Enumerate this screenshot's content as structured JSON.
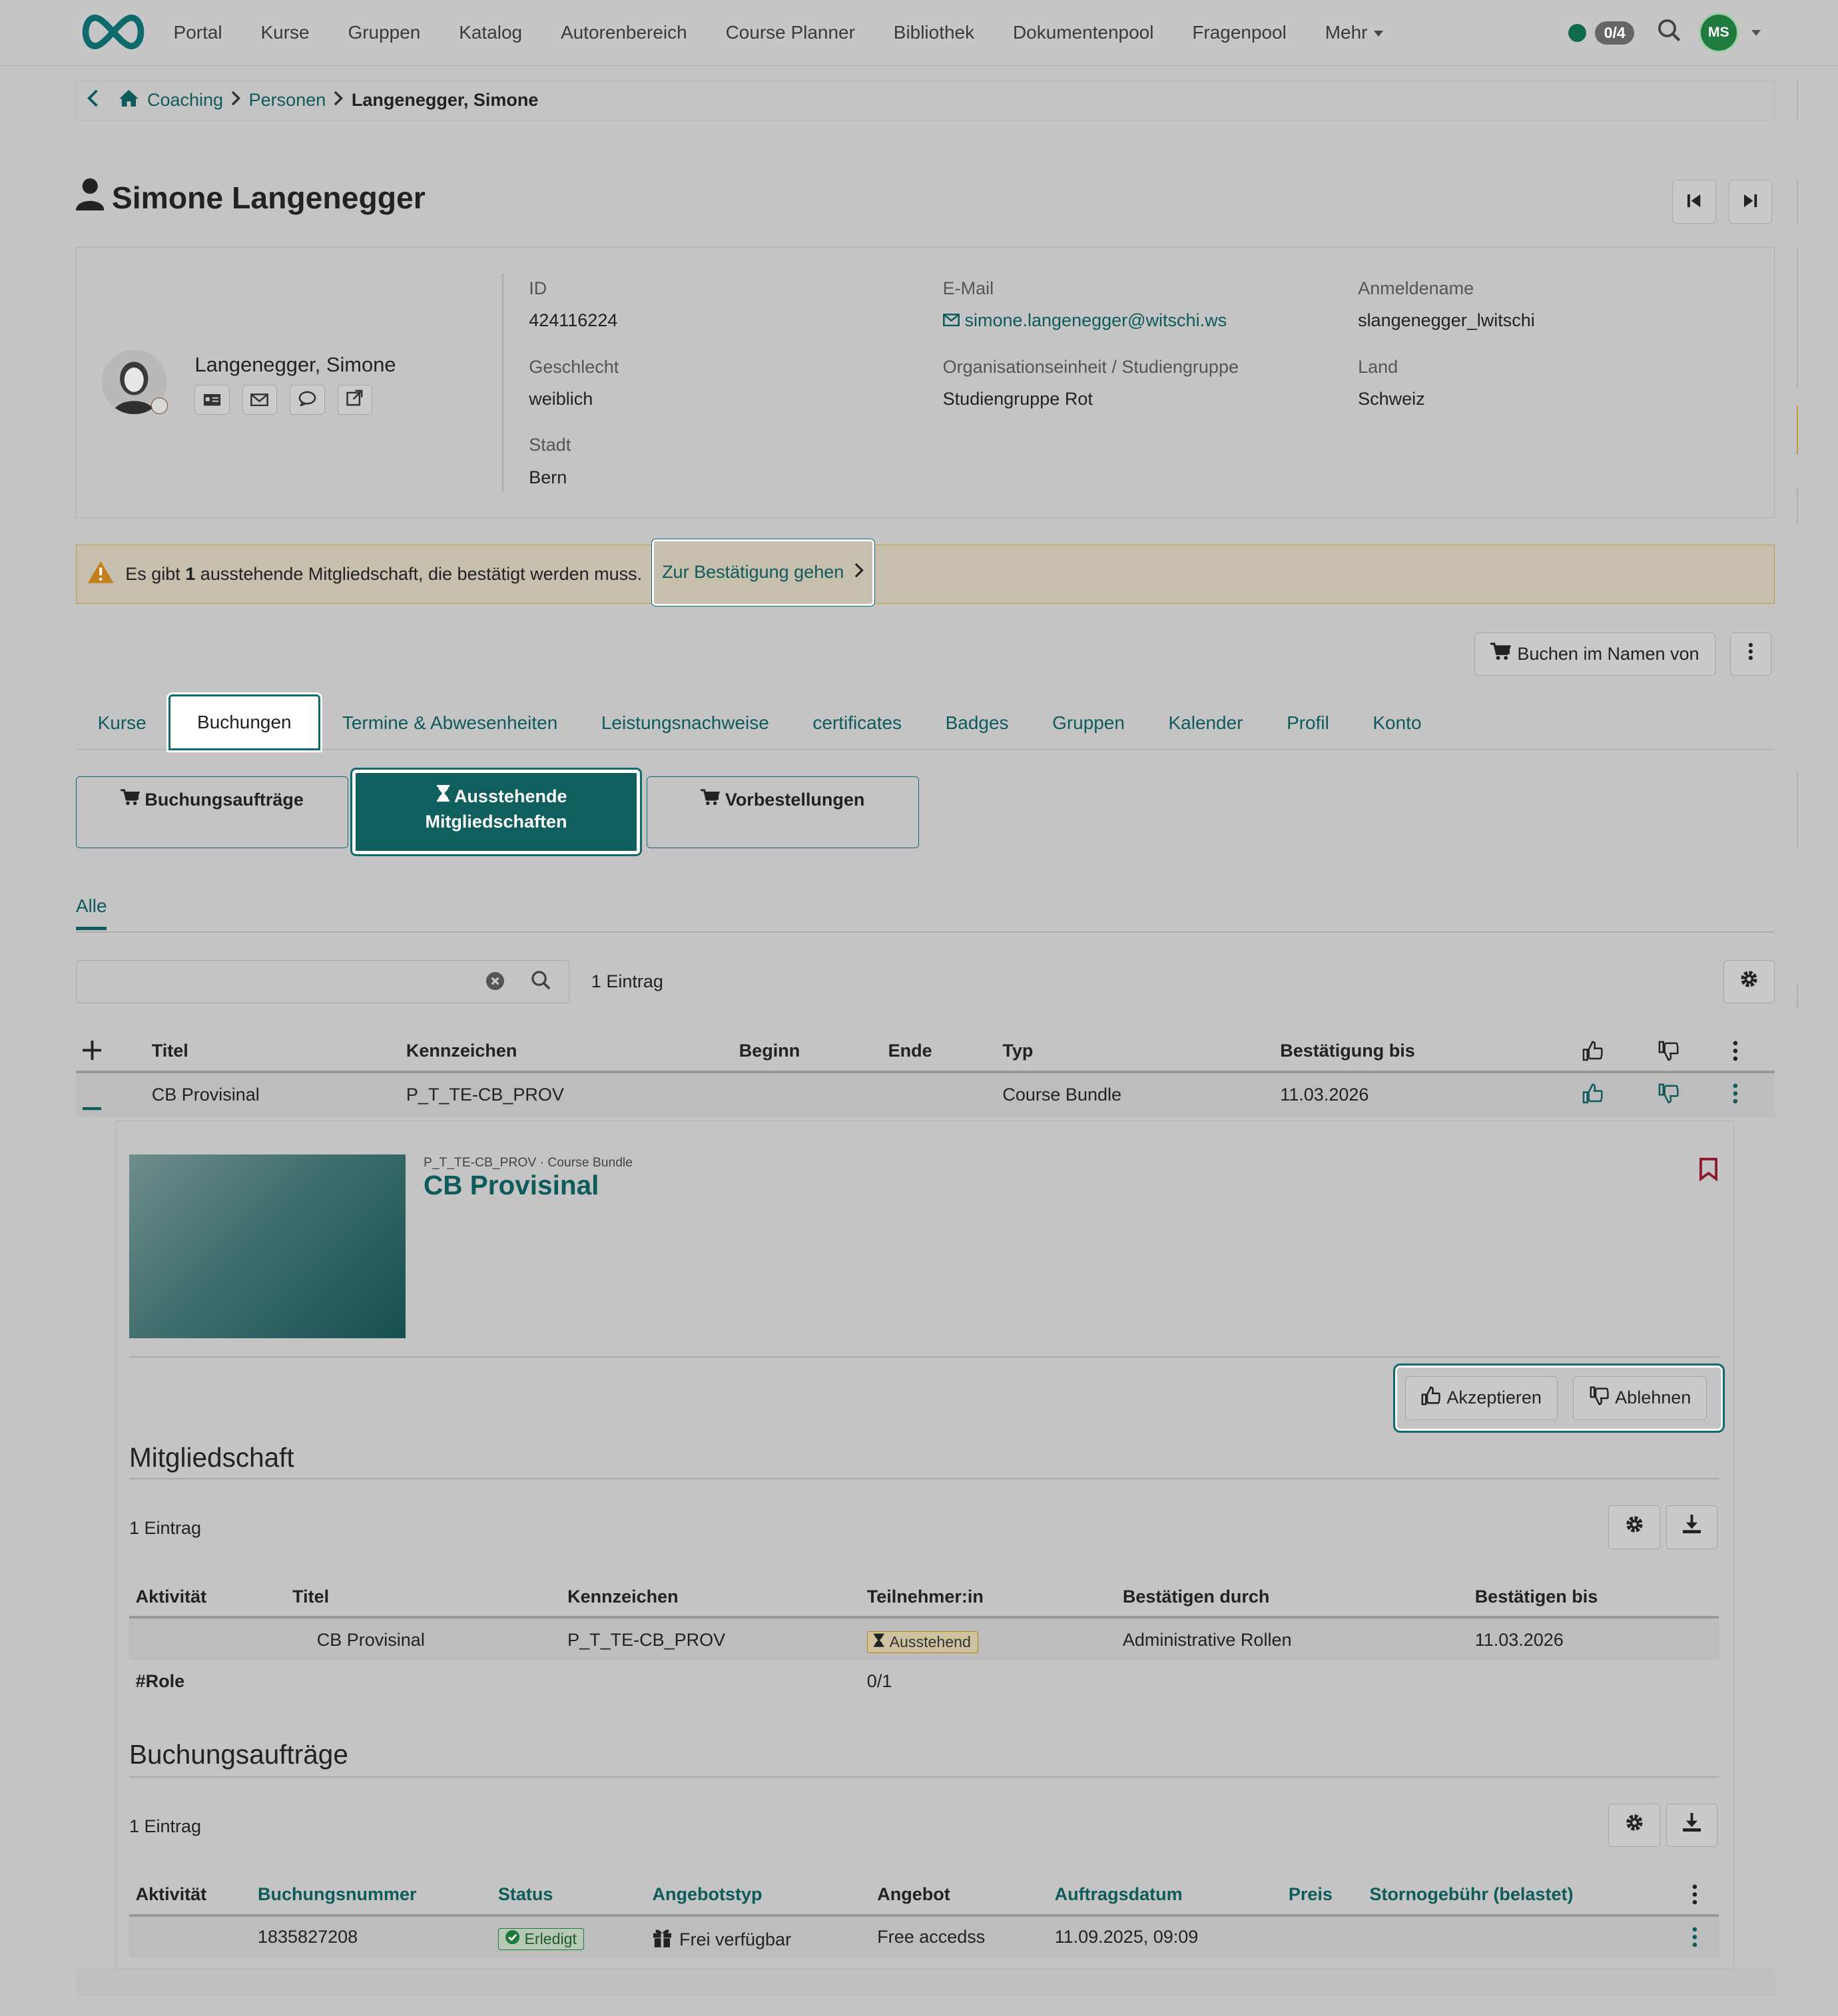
{
  "nav": {
    "items": [
      "Portal",
      "Kurse",
      "Gruppen",
      "Katalog",
      "Autorenbereich",
      "Course Planner",
      "Bibliothek",
      "Dokumentenpool",
      "Fragenpool",
      "Mehr"
    ],
    "badge": "0/4",
    "avatar_initials": "MS"
  },
  "breadcrumb": {
    "items": [
      "Coaching",
      "Personen"
    ],
    "current": "Langenegger, Simone"
  },
  "page_title": "Simone Langenegger",
  "profile": {
    "display_name": "Langenegger, Simone",
    "fields": {
      "id_label": "ID",
      "id_value": "424116224",
      "gender_label": "Geschlecht",
      "gender_value": "weiblich",
      "city_label": "Stadt",
      "city_value": "Bern",
      "email_label": "E-Mail",
      "email_value": "simone.langenegger@witschi.ws",
      "org_label": "Organisationseinheit / Studiengruppe",
      "org_value": "Studiengruppe Rot",
      "login_label": "Anmeldename",
      "login_value": "slangenegger_lwitschi",
      "country_label": "Land",
      "country_value": "Schweiz"
    }
  },
  "alert": {
    "pre": "Es gibt",
    "count": "1",
    "post": "ausstehende Mitgliedschaft, die bestätigt werden muss.",
    "action": "Zur Bestätigung gehen"
  },
  "actions": {
    "book_on_behalf": "Buchen im Namen von"
  },
  "tabs": [
    "Kurse",
    "Buchungen",
    "Termine & Abwesenheiten",
    "Leistungsnachweise",
    "certificates",
    "Badges",
    "Gruppen",
    "Kalender",
    "Profil",
    "Konto"
  ],
  "subtabs": {
    "orders": "Buchungsaufträge",
    "pending_1": "Ausstehende",
    "pending_2": "Mitgliedschaften",
    "preorders": "Vorbestellungen"
  },
  "filter_tab": "Alle",
  "search": {
    "placeholder": "",
    "count": "1 Eintrag"
  },
  "table": {
    "headers": [
      "Titel",
      "Kennzeichen",
      "Beginn",
      "Ende",
      "Typ",
      "Bestätigung bis"
    ],
    "row": {
      "title": "CB Provisinal",
      "code": "P_T_TE-CB_PROV",
      "begin": "",
      "end": "",
      "type": "Course Bundle",
      "confirm_until": "11.03.2026"
    }
  },
  "detail": {
    "meta": "P_T_TE-CB_PROV · Course Bundle",
    "title": "CB Provisinal",
    "accept": "Akzeptieren",
    "reject": "Ablehnen",
    "membership": {
      "heading": "Mitgliedschaft",
      "count": "1 Eintrag",
      "headers": [
        "Aktivität",
        "Titel",
        "Kennzeichen",
        "Teilnehmer:in",
        "Bestätigen durch",
        "Bestätigen bis"
      ],
      "row": {
        "title": "CB Provisinal",
        "code": "P_T_TE-CB_PROV",
        "status": "Ausstehend",
        "confirm_by": "Administrative Rollen",
        "confirm_until": "11.03.2026"
      },
      "footer": {
        "label": "#Role",
        "value": "0/1"
      }
    },
    "orders": {
      "heading": "Buchungsaufträge",
      "count": "1 Eintrag",
      "headers": [
        "Aktivität",
        "Buchungsnummer",
        "Status",
        "Angebotstyp",
        "Angebot",
        "Auftragsdatum",
        "Preis",
        "Stornogebühr (belastet)"
      ],
      "row": {
        "number": "1835827208",
        "status": "Erledigt",
        "offer_type": "Frei verfügbar",
        "offer": "Free accedss",
        "date": "11.09.2025, 09:09"
      }
    }
  },
  "colors": {
    "accent": "#0f5f5f",
    "background": "#c4c4c4",
    "warning": "#c49a3a",
    "success": "#1c7a3a"
  }
}
